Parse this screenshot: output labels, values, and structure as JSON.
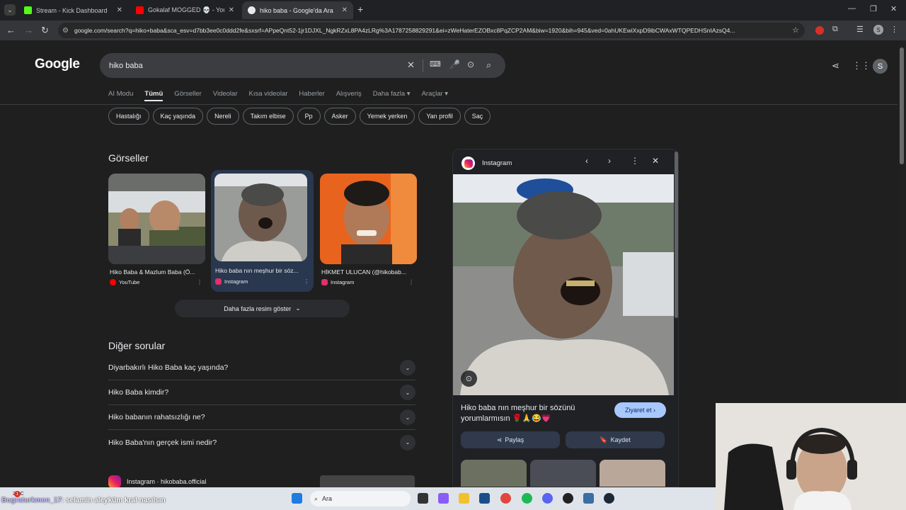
{
  "browser": {
    "tabs": [
      {
        "title": "Stream - Kick Dashboard",
        "fav_color": "#53fc18"
      },
      {
        "title": "Gokalaf MOGGED 💀 - YouTube",
        "fav_color": "#ff0000"
      },
      {
        "title": "hiko baba - Google'da Ara",
        "fav_color": "#e8eaed"
      }
    ],
    "url": "google.com/search?q=hiko+baba&sca_esv=d7bb3ee0c0ddd2fe&sxsrf=APpeQnt52-1jr1DJXL_NgkRZxL8PA4zLRg%3A1787258829291&ei=zWeHaterEZOBxc8PqZCP2AM&biw=1920&bih=945&ved=0ahUKEwiXxpD9ibCWAxWTQPEDHSnIAzsQ4...",
    "profile_initial": "S"
  },
  "google": {
    "logo": "Google",
    "query": "hiko baba",
    "avatar_initial": "S",
    "tabs": [
      "AI Modu",
      "Tümü",
      "Görseller",
      "Videolar",
      "Kısa videolar",
      "Haberler",
      "Alışveriş",
      "Daha fazla ▾",
      "Araçlar ▾"
    ],
    "chips": [
      "Hastalığı",
      "Kaç yaşında",
      "Nereli",
      "Takım elbise",
      "Pp",
      "Asker",
      "Yemek yerken",
      "Yan profil",
      "Saç"
    ],
    "images_heading": "Görseller",
    "images": [
      {
        "caption": "Hiko Baba & Mazlum Baba (Ö...",
        "source": "YouTube",
        "src_color": "#ff0000"
      },
      {
        "caption": "Hiko baba nın meşhur bir söz...",
        "source": "Instagram",
        "src_color": "#e1306c"
      },
      {
        "caption": "HİKMET ULUCAN (@hikobab...",
        "source": "Instagram",
        "src_color": "#e1306c"
      }
    ],
    "more_images": "Daha fazla resim göster",
    "faq_heading": "Diğer sorular",
    "faq": [
      "Diyarbakırlı Hiko Baba kaç yaşında?",
      "Hiko Baba kimdir?",
      "Hiko babanın rahatsızlığı ne?",
      "Hiko Baba'nın gerçek ismi nedir?"
    ],
    "result_source": "Instagram · hikobaba.official"
  },
  "panel": {
    "source": "Instagram",
    "title": "Hiko baba nın meşhur bir sözünü yorumlarmısın 🌹🙏😂💗",
    "visit": "Ziyaret et",
    "share": "Paylaş",
    "save": "Kaydet"
  },
  "overlay": {
    "chat_user": "Bugraturkmen_17",
    "chat_text": ": selamin aleyküm kral nasılsın",
    "badge": "1"
  },
  "taskbar": {
    "weather": "24°C",
    "search_placeholder": "Ara"
  }
}
